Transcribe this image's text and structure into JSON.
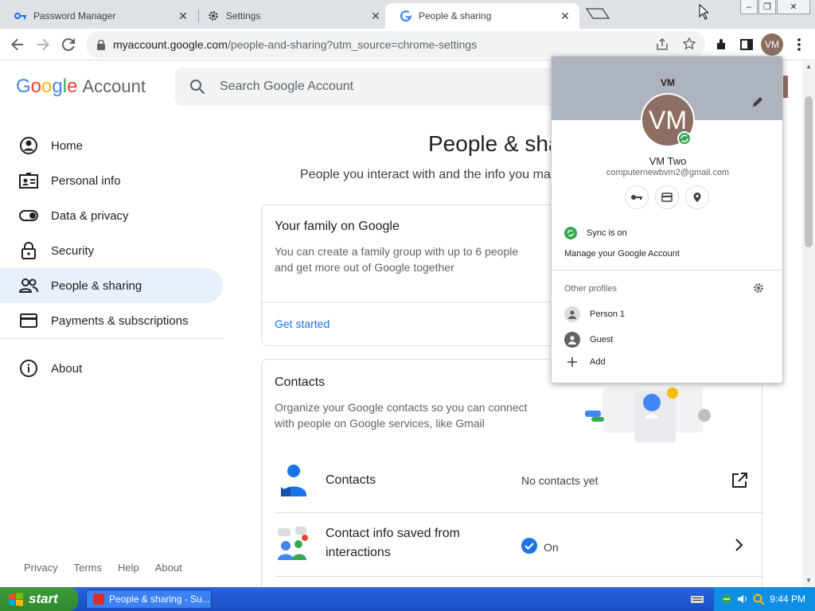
{
  "browser": {
    "tabs": [
      {
        "title": "Password Manager",
        "icon": "key-icon",
        "close": "✕"
      },
      {
        "title": "Settings",
        "icon": "gear-icon",
        "close": "✕"
      },
      {
        "title": "People & sharing",
        "icon": "google-g-icon",
        "close": "✕"
      }
    ],
    "url_host": "myaccount.google.com",
    "url_path": "/people-and-sharing?utm_source=chrome-settings",
    "avatar": "VM",
    "window_controls": [
      "–",
      "❐",
      "✕"
    ]
  },
  "account": {
    "logo_google": "Google",
    "logo_account": "Account",
    "search_placeholder": "Search Google Account",
    "nav": [
      {
        "label": "Home",
        "icon": "home-icon"
      },
      {
        "label": "Personal info",
        "icon": "id-card-icon"
      },
      {
        "label": "Data & privacy",
        "icon": "toggle-icon"
      },
      {
        "label": "Security",
        "icon": "lock-icon"
      },
      {
        "label": "People & sharing",
        "icon": "people-icon",
        "active": true
      },
      {
        "label": "Payments & subscriptions",
        "icon": "card-icon"
      },
      {
        "label": "About",
        "icon": "info-icon"
      }
    ],
    "footer": [
      "Privacy",
      "Terms",
      "Help",
      "About"
    ],
    "page_title": "People & sha",
    "page_subtitle": "People you interact with and the info you ma",
    "family_card": {
      "title": "Your family on Google",
      "text_line1": "You can create a family group with up to 6 people",
      "text_line2": "and get more out of Google together",
      "link": "Get started"
    },
    "contacts_card": {
      "title": "Contacts",
      "text_line1": "Organize your Google contacts so you can connect",
      "text_line2": "with people on Google services, like Gmail",
      "rows": [
        {
          "label": "Contacts",
          "status": "No contacts yet"
        },
        {
          "label_line1": "Contact info saved from",
          "label_line2": "interactions",
          "status": "On"
        }
      ]
    }
  },
  "profile_menu": {
    "initials": "VM",
    "name": "VM Two",
    "email": "computernewbvm2@gmail.com",
    "sync": "Sync is on",
    "manage": "Manage your Google Account",
    "other_profiles": "Other profiles",
    "profiles": [
      "Person 1",
      "Guest"
    ],
    "add": "Add"
  },
  "taskbar": {
    "start": "start",
    "task": "People & sharing - Su...",
    "clock": "9:44 PM"
  },
  "colors": {
    "accent": "#1a73e8",
    "active_nav": "#e8f0fe",
    "avatar": "#8d6e63",
    "sync_green": "#34a853"
  }
}
